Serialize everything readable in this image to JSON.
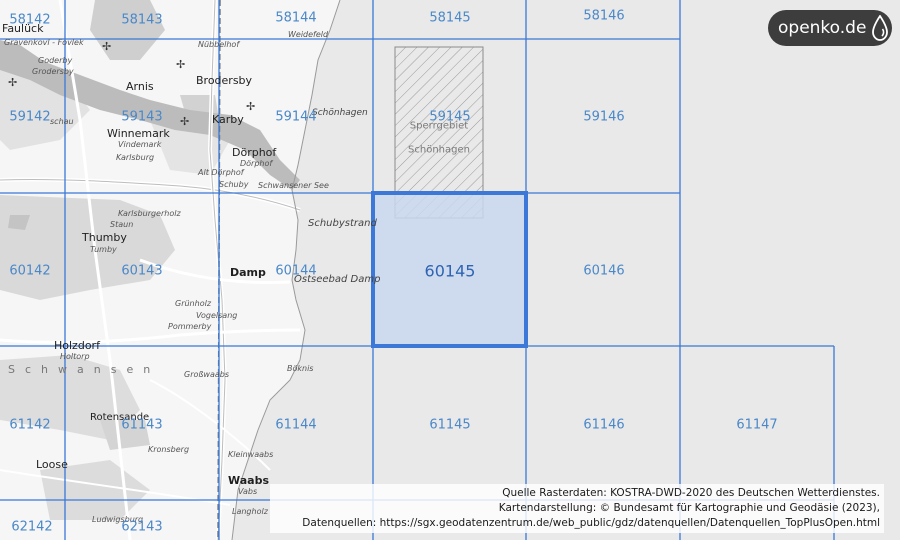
{
  "brand": {
    "name": "openko.de",
    "icon": "drop-icon"
  },
  "grid": {
    "highlighted_cell": "60145",
    "cells": [
      {
        "id": "58142"
      },
      {
        "id": "58143"
      },
      {
        "id": "58144"
      },
      {
        "id": "58145"
      },
      {
        "id": "58146"
      },
      {
        "id": "59142"
      },
      {
        "id": "59143"
      },
      {
        "id": "59144"
      },
      {
        "id": "59145"
      },
      {
        "id": "59146"
      },
      {
        "id": "60142"
      },
      {
        "id": "60143"
      },
      {
        "id": "60144"
      },
      {
        "id": "60145"
      },
      {
        "id": "60146"
      },
      {
        "id": "61142"
      },
      {
        "id": "61143"
      },
      {
        "id": "61144"
      },
      {
        "id": "61145"
      },
      {
        "id": "61146"
      },
      {
        "id": "61147"
      },
      {
        "id": "62142"
      },
      {
        "id": "62143"
      }
    ]
  },
  "restricted_area": {
    "line1": "Sperrgebiet",
    "line2": "Schönhagen"
  },
  "places": [
    "Faulück",
    "Brodersby",
    "Arnis",
    "Karby",
    "Winnemark",
    "Vindemark",
    "Karlsburg",
    "Dörphof",
    "Dörphof",
    "Alt Dörphof",
    "Schuby",
    "Schwansener See",
    "Schönhagen",
    "Schubystrand",
    "Thumby",
    "Tumby",
    "Staun",
    "Karlsburgerholz",
    "Damp",
    "Ostseebad Damp",
    "Grünholz",
    "Vogelsang",
    "Pommerby",
    "Holzdorf",
    "Holtorp",
    "Großwaabs",
    "Böknis",
    "Rotensande",
    "Loose",
    "Vabs",
    "Waabs",
    "Kleinwaabs",
    "Kronsberg",
    "Ludwigsburg",
    "Langholz",
    "Goderby",
    "Gravenkovl - Fovlek",
    "Nübbelhof",
    "Weidefeld",
    "schau",
    "Grodersby",
    "Schwansen"
  ],
  "credits": {
    "line1": "Quelle Rasterdaten: KOSTRA-DWD-2020 des Deutschen Wetterdienstes.",
    "line2": "Kartendarstellung: © Bundesamt für Kartographie und Geodäsie (2023),",
    "line3": "Datenquellen: https://sgx.geodatenzentrum.de/web_public/gdz/datenquellen/Datenquellen_TopPlusOpen.html"
  },
  "colors": {
    "grid_line": "#3b78d8",
    "highlight_fill": "#c9d7ee",
    "highlight_border": "#3b78d8",
    "cell_label": "#4a88c9"
  }
}
